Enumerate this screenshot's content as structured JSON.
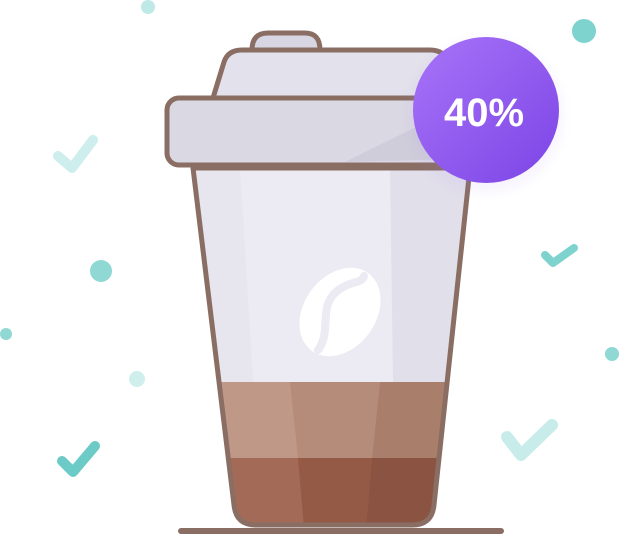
{
  "badge": {
    "label": "40%"
  },
  "illustration": {
    "subject": "coffee-cup",
    "fill_level": 0.4,
    "emblem_icon": "coffee-bean-icon",
    "decoration_icon": "checkmark-icon"
  },
  "colors": {
    "outline": "#8A6E64",
    "cup_body": "#ECEAF2",
    "lid": "#DAD8E3",
    "coffee_light": "#BA9283",
    "coffee_dark": "#9A5E4A",
    "badge_start": "#A06CF6",
    "badge_end": "#8048E8",
    "accent_teal": "#7ED3CF"
  }
}
